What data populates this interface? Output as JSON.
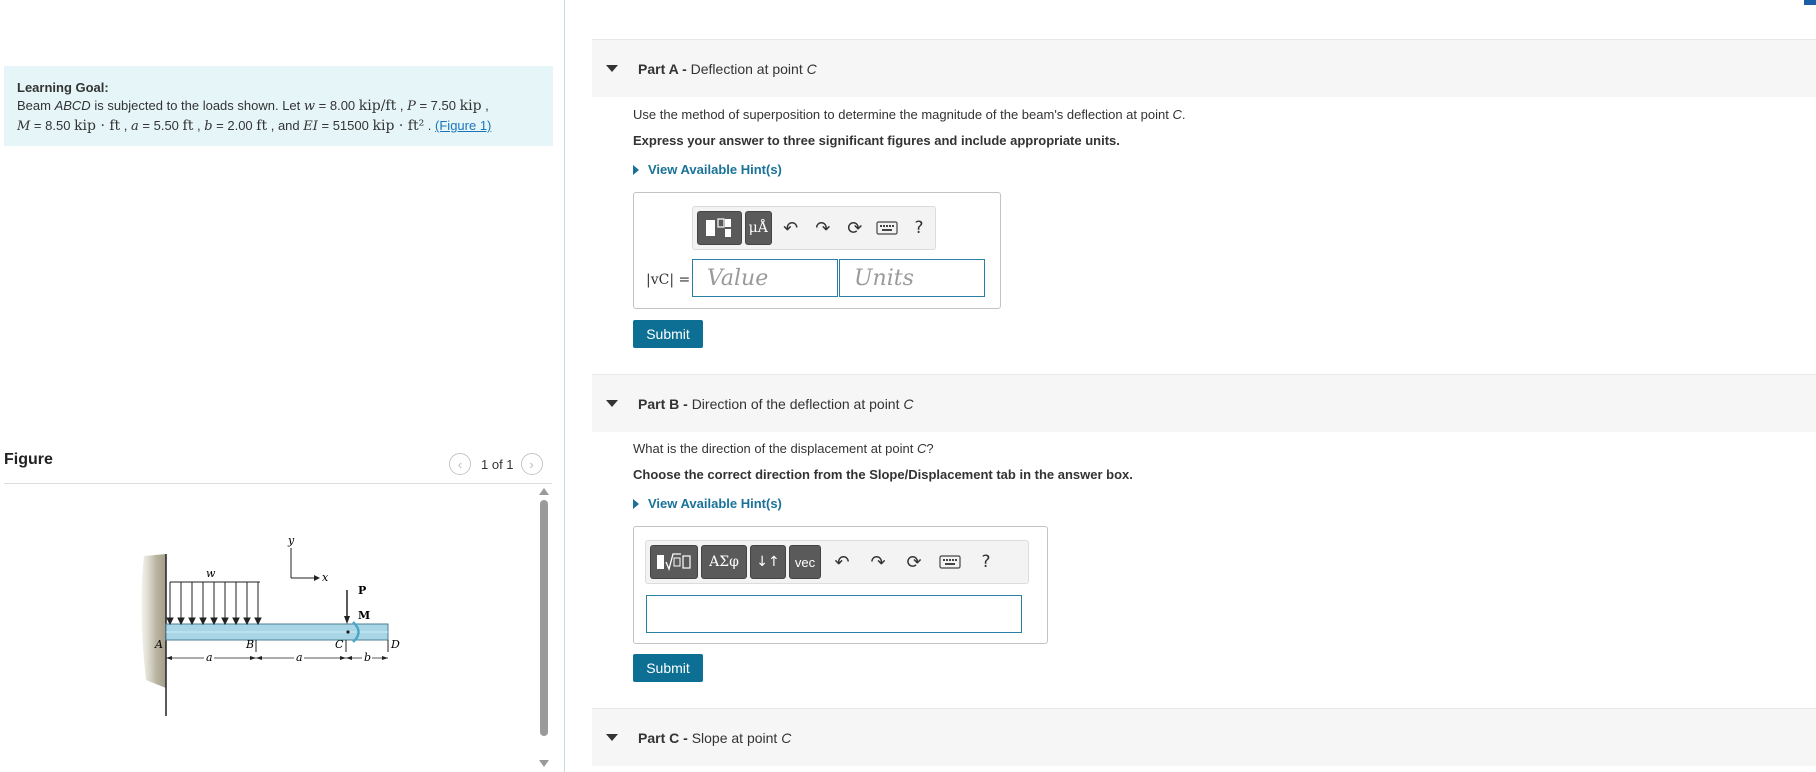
{
  "learning_goal": {
    "title": "Learning Goal:",
    "line1_prefix": "Beam ",
    "beam_name": "ABCD",
    "line1_middle": " is subjected to the loads shown. Let ",
    "w_value": "8.00",
    "w_unit": "kip/ft",
    "p_value": "7.50",
    "p_unit": "kip",
    "m_value": "8.50",
    "m_unit": "kip · ft",
    "a_value": "5.50",
    "a_unit": "ft",
    "b_value": "2.00",
    "b_unit": "ft",
    "ei_value": "51500",
    "ei_unit": "kip · ft²",
    "figure_link": "(Figure 1)"
  },
  "figure": {
    "label": "Figure",
    "pager": "1 of 1",
    "prev_icon": "chevron-left-icon",
    "next_icon": "chevron-right-icon",
    "diagram_labels": {
      "y": "y",
      "x": "x",
      "w": "w",
      "P": "P",
      "M": "M",
      "A": "A",
      "B": "B",
      "C": "C",
      "D": "D",
      "a1": "a",
      "a2": "a",
      "b": "b"
    }
  },
  "parts": [
    {
      "label": "Part A -",
      "title": "Deflection at point ",
      "title_point": "C",
      "question_prefix": "Use the method of superposition to determine the magnitude of the beam's deflection at point ",
      "question_point": "C",
      "question_suffix": ".",
      "instruction": "Express your answer to three significant figures and include appropriate units.",
      "hint": "View Available Hint(s)",
      "answer_label": "|vC| =",
      "value_placeholder": "Value",
      "units_placeholder": "Units",
      "toolbar": {
        "templates_icon": "templates-icon",
        "units_symbol": "μÅ",
        "undo_icon": "undo-icon",
        "redo_icon": "redo-icon",
        "reset_icon": "reset-icon",
        "keyboard_icon": "keyboard-icon",
        "help": "?"
      },
      "submit": "Submit"
    },
    {
      "label": "Part B -",
      "title": "Direction of the deflection at point ",
      "title_point": "C",
      "question_prefix": "What is the direction of the displacement at point ",
      "question_point": "C",
      "question_suffix": "?",
      "instruction": "Choose the correct direction from the Slope/Displacement tab in the answer box.",
      "hint": "View Available Hint(s)",
      "toolbar": {
        "templates_icon": "radical-template-icon",
        "greek": "ΑΣφ",
        "arrows": "↓↑",
        "vec": "vec",
        "help": "?"
      },
      "submit": "Submit"
    },
    {
      "label": "Part C -",
      "title": "Slope at point ",
      "title_point": "C"
    }
  ],
  "colors": {
    "accent": "#0d6f94",
    "link": "#1a7299",
    "goal_bg": "#e6f6f8",
    "beam": "#a8d6e6"
  }
}
